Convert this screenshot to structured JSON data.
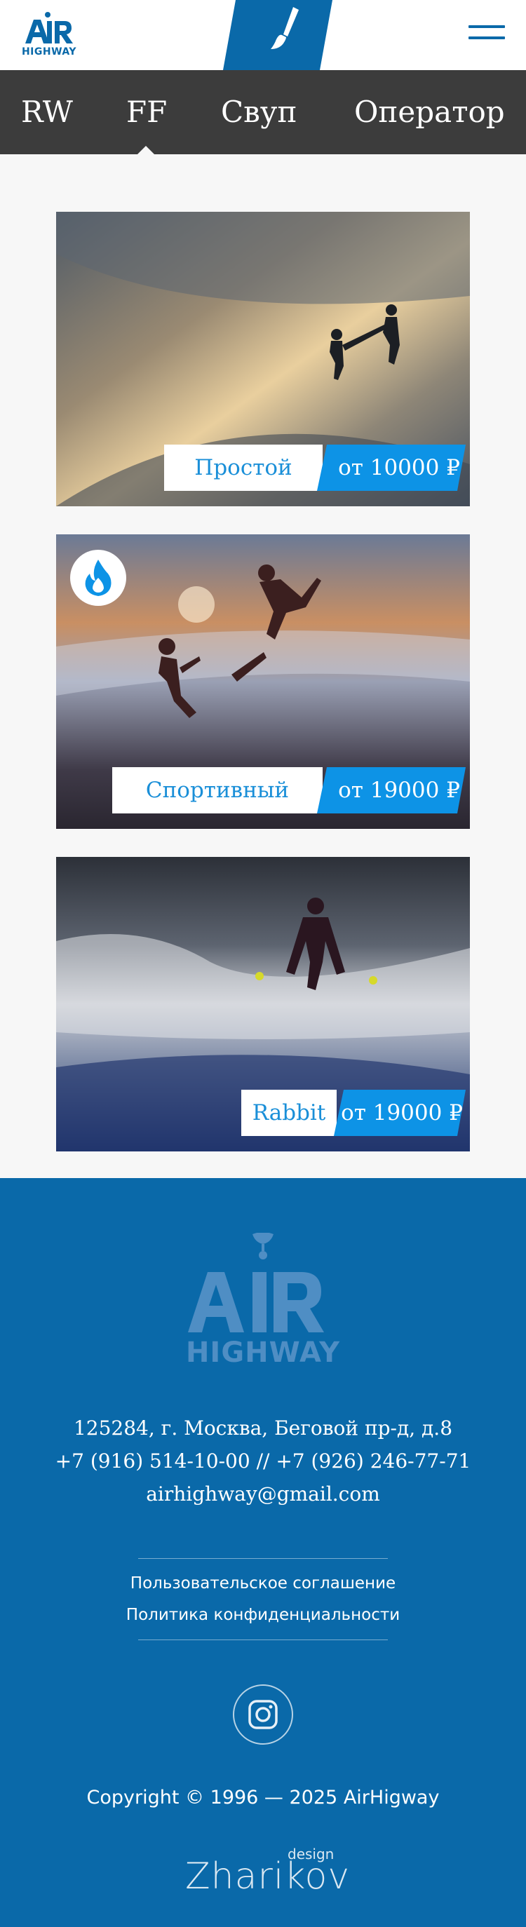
{
  "header": {
    "logo_text": "HIGHWAY",
    "brush_icon": "paint-brush-icon",
    "menu_icon": "hamburger-menu-icon"
  },
  "tabs": {
    "items": [
      "RW",
      "FF",
      "Свуп",
      "Оператор"
    ],
    "active": "FF"
  },
  "cards": [
    {
      "name": "Простой",
      "price": "от 10000 ₽",
      "hot": false
    },
    {
      "name": "Спортивный",
      "price": "от 19000 ₽",
      "hot": true,
      "badge_icon": "fire-icon"
    },
    {
      "name": "Rabbit",
      "price": "от 19000 ₽",
      "hot": false
    }
  ],
  "footer": {
    "logo_text": "HIGHWAY",
    "address": "125284, г. Москва, Беговой пр-д, д.8",
    "phones": "+7 (916) 514-10-00 // +7 (926) 246-77-71",
    "email": "airhighway@gmail.com",
    "links": [
      "Пользовательское соглашение",
      "Политика конфиденциальности"
    ],
    "social_icon": "instagram-icon",
    "copyright": "Copyright © 1996 — 2025 AirHigway",
    "designer_top": "design",
    "designer_name": "Zharikov"
  },
  "colors": {
    "brand_blue": "#0a69a9",
    "accent_blue": "#0d93e6",
    "tab_bar": "#3c3c3c",
    "page_bg": "#f7f7f7"
  }
}
